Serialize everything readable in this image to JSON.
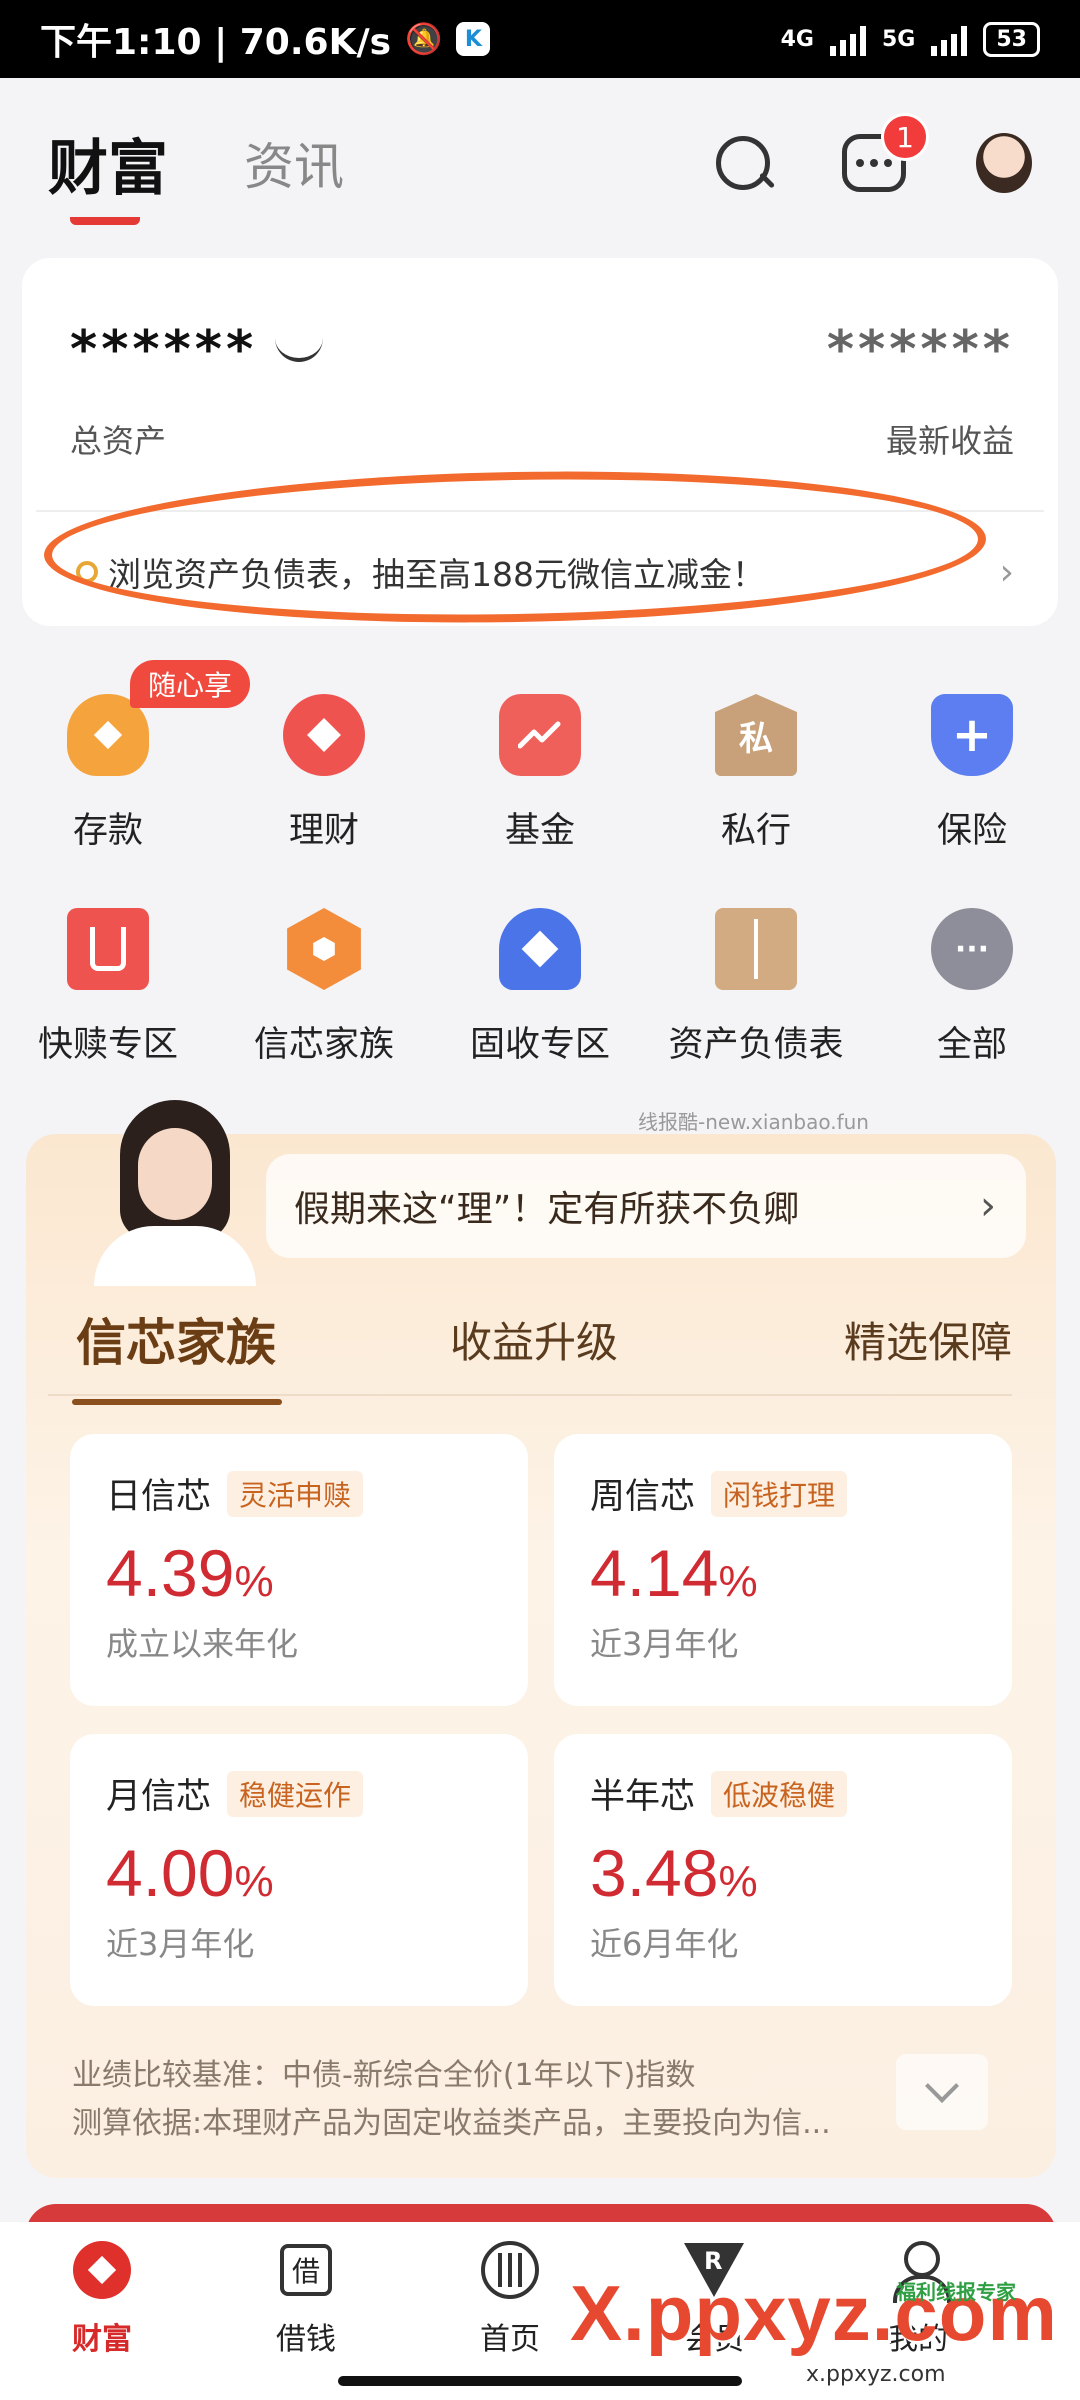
{
  "status_bar": {
    "time_speed": "下午1:10 | 70.6K/s",
    "app_badge": "K",
    "network_1": "4G",
    "network_2": "5G",
    "battery": "53"
  },
  "header": {
    "tab_active": "财富",
    "tab_other": "资讯",
    "message_badge": "1"
  },
  "assets": {
    "total_masked": "******",
    "income_masked": "******",
    "total_label": "总资产",
    "income_label": "最新收益",
    "promo_text": "浏览资产负债表，抽至高188元微信立减金！"
  },
  "grid": {
    "row1": [
      {
        "label": "存款",
        "tag": "随心享"
      },
      {
        "label": "理财"
      },
      {
        "label": "基金"
      },
      {
        "label": "私行",
        "icon_text": "私"
      },
      {
        "label": "保险",
        "icon_text": "+"
      }
    ],
    "row2": [
      {
        "label": "快赎专区"
      },
      {
        "label": "信芯家族"
      },
      {
        "label": "固收专区"
      },
      {
        "label": "资产负债表"
      },
      {
        "label": "全部",
        "icon_text": "···"
      }
    ]
  },
  "watermark_text": "线报酷-new.xianbao.fun",
  "xinxin": {
    "banner": "假期来这“理”！定有所获不负卿",
    "tabs": [
      "信芯家族",
      "收益升级",
      "精选保障"
    ],
    "cards": [
      {
        "name": "日信芯",
        "tag": "灵活申赎",
        "rate": "4.39",
        "pct": "%",
        "desc": "成立以来年化"
      },
      {
        "name": "周信芯",
        "tag": "闲钱打理",
        "rate": "4.14",
        "pct": "%",
        "desc": "近3月年化"
      },
      {
        "name": "月信芯",
        "tag": "稳健运作",
        "rate": "4.00",
        "pct": "%",
        "desc": "近3月年化"
      },
      {
        "name": "半年芯",
        "tag": "低波稳健",
        "rate": "3.48",
        "pct": "%",
        "desc": "近6月年化"
      }
    ],
    "benchmark": "业绩比较基准：中债-新综合全价(1年以下)指数",
    "basis": "测算依据:本理财产品为固定收益类产品，主要投向为信..."
  },
  "bottom_nav": [
    {
      "label": "财富",
      "icon": "wealth-icon"
    },
    {
      "label": "借钱",
      "icon_text": "借"
    },
    {
      "label": "首页"
    },
    {
      "label": "会员",
      "icon_text": "R"
    },
    {
      "label": "我的"
    }
  ],
  "overlay": {
    "brand": "X.ppxyz.com",
    "brand_small": "福利线报专家",
    "url": "x.ppxyz.com"
  },
  "colors": {
    "accent_red": "#e0302c",
    "rate_red": "#d02b32",
    "promo_circle": "#f26a2e"
  }
}
